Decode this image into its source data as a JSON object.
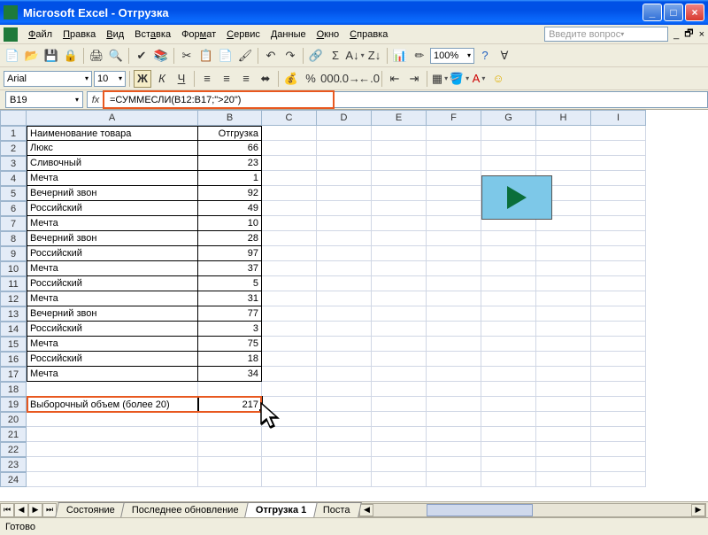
{
  "titlebar": {
    "app": "Microsoft Excel",
    "doc": "Отгрузка"
  },
  "menu": {
    "file": "Файл",
    "edit": "Правка",
    "view": "Вид",
    "insert": "Вставка",
    "format": "Формат",
    "tools": "Сервис",
    "data": "Данные",
    "window": "Окно",
    "help": "Справка",
    "helpbox": "Введите вопрос"
  },
  "format_tb": {
    "font": "Arial",
    "size": "10",
    "zoom": "100%"
  },
  "formula": {
    "cellref": "B19",
    "formula": "=СУММЕСЛИ(B12:B17;\">20\")",
    "fx": "fx"
  },
  "columns": [
    "A",
    "B",
    "C",
    "D",
    "E",
    "F",
    "G",
    "H",
    "I"
  ],
  "header_row": {
    "a": "Наименование товара",
    "b": "Отгрузка"
  },
  "data_rows": [
    {
      "a": "Люкс",
      "b": "66"
    },
    {
      "a": "Сливочный",
      "b": "23"
    },
    {
      "a": "Мечта",
      "b": "1"
    },
    {
      "a": "Вечерний звон",
      "b": "92"
    },
    {
      "a": "Российский",
      "b": "49"
    },
    {
      "a": "Мечта",
      "b": "10"
    },
    {
      "a": "Вечерний звон",
      "b": "28"
    },
    {
      "a": "Российский",
      "b": "97"
    },
    {
      "a": "Мечта",
      "b": "37"
    },
    {
      "a": "Российский",
      "b": "5"
    },
    {
      "a": "Мечта",
      "b": "31"
    },
    {
      "a": "Вечерний звон",
      "b": "77"
    },
    {
      "a": "Российский",
      "b": "3"
    },
    {
      "a": "Мечта",
      "b": "75"
    },
    {
      "a": "Российский",
      "b": "18"
    },
    {
      "a": "Мечта",
      "b": "34"
    }
  ],
  "summary": {
    "label": "Выборочный объем (более 20)",
    "value": "217"
  },
  "tabs": {
    "t1": "Состояние",
    "t2": "Последнее обновление",
    "t3": "Отгрузка 1",
    "t4": "Поста"
  },
  "status": "Готово"
}
